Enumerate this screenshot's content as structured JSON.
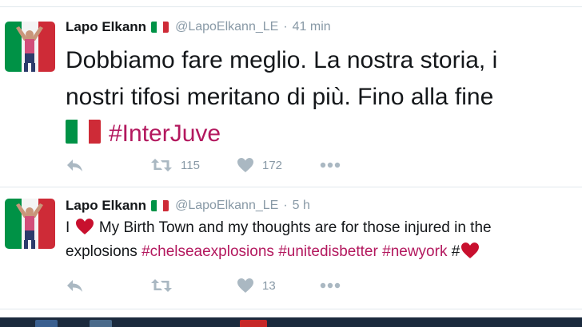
{
  "colors": {
    "hashtag": "#b3185e",
    "meta": "#8899a6",
    "heart": "#c8102e"
  },
  "tweets": [
    {
      "name": "Lapo Elkann",
      "handle": "@LapoElkann_LE",
      "separator": "·",
      "time": "41 min",
      "text_line1": "Dobbiamo fare meglio. La nostra storia, i",
      "text_line2": "nostri tifosi meritano di più. Fino alla fine",
      "hashtag": "#InterJuve",
      "retweets": "115",
      "likes": "172"
    },
    {
      "name": "Lapo Elkann",
      "handle": "@LapoElkann_LE",
      "separator": "·",
      "time": "5 h",
      "text_i": "I",
      "text_after_heart": "My Birth Town and my thoughts are for those injured in the",
      "text_line2": "explosions",
      "hashtags": [
        "#chelseaexplosions",
        "#unitedisbetter",
        "#newyork"
      ],
      "hash_mark": "#",
      "retweets": "",
      "likes": "13"
    }
  ],
  "icons": [
    "reply-icon",
    "retweet-icon",
    "like-icon",
    "more-icon",
    "heart-emoji-icon",
    "italy-flag-icon"
  ]
}
